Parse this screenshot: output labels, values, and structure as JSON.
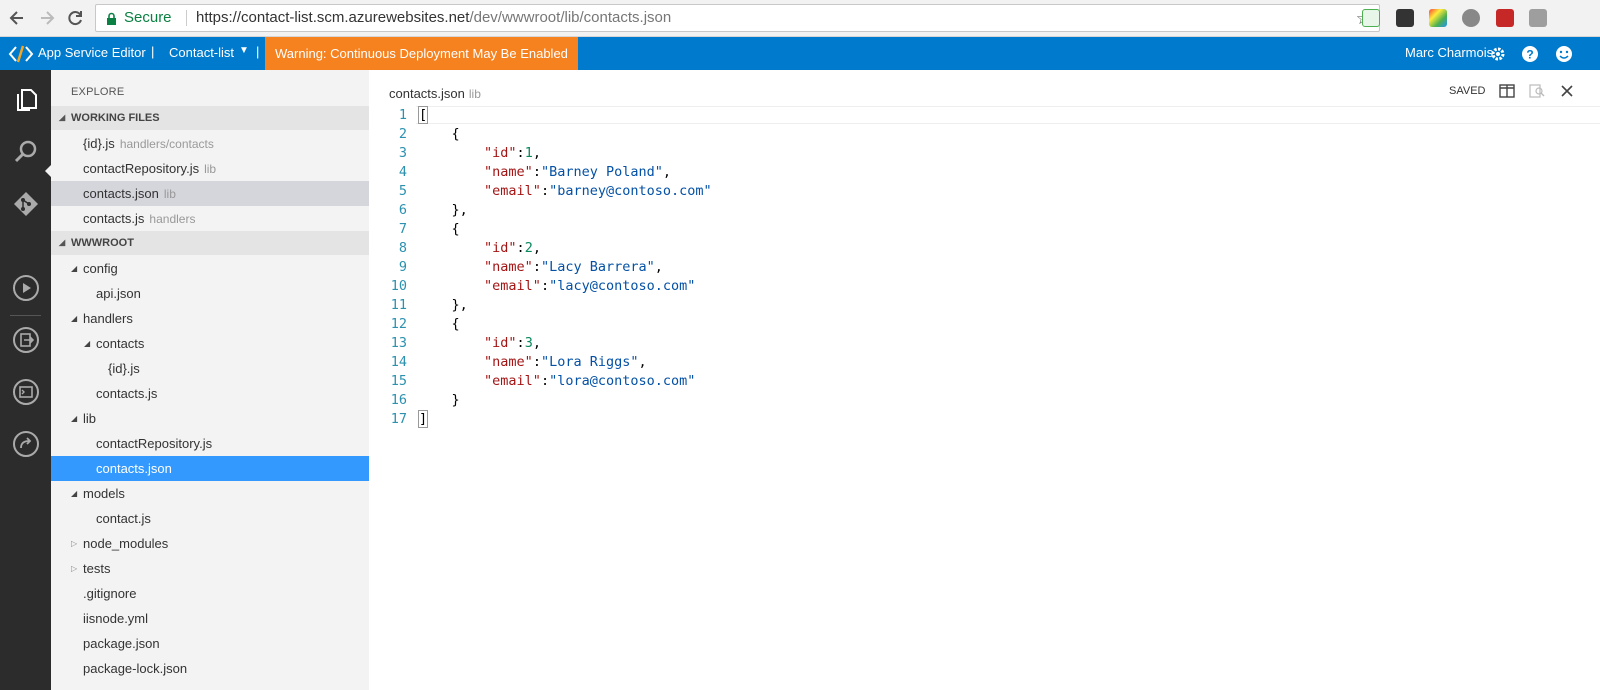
{
  "browser": {
    "secure_label": "Secure",
    "url_host": "https://contact-list.scm.azurewebsites.net",
    "url_path": "/dev/wwwroot/lib/contacts.json"
  },
  "header": {
    "app_name": "App Service Editor",
    "site_name": "Contact-list",
    "warning": "Warning: Continuous Deployment May Be Enabled",
    "user": "Marc Charmois",
    "accent_color": "#007acc",
    "warning_color": "#f5811f"
  },
  "sidebar": {
    "explore_label": "EXPLORE",
    "working_files_label": "WORKING FILES",
    "working_files": [
      {
        "name": "{id}.js",
        "desc": "handlers/contacts"
      },
      {
        "name": "contactRepository.js",
        "desc": "lib"
      },
      {
        "name": "contacts.json",
        "desc": "lib"
      },
      {
        "name": "contacts.js",
        "desc": "handlers"
      }
    ],
    "root_label": "WWWROOT",
    "tree": [
      {
        "name": "config"
      },
      {
        "name": "api.json"
      },
      {
        "name": "handlers"
      },
      {
        "name": "contacts"
      },
      {
        "name": "{id}.js"
      },
      {
        "name": "contacts.js"
      },
      {
        "name": "lib"
      },
      {
        "name": "contactRepository.js"
      },
      {
        "name": "contacts.json"
      },
      {
        "name": "models"
      },
      {
        "name": "contact.js"
      },
      {
        "name": "node_modules"
      },
      {
        "name": "tests"
      },
      {
        "name": ".gitignore"
      },
      {
        "name": "iisnode.yml"
      },
      {
        "name": "package.json"
      },
      {
        "name": "package-lock.json"
      }
    ]
  },
  "editor": {
    "file_name": "contacts.json",
    "file_dir": "lib",
    "status": "SAVED",
    "line_numbers": [
      "1",
      "2",
      "3",
      "4",
      "5",
      "6",
      "7",
      "8",
      "9",
      "10",
      "11",
      "12",
      "13",
      "14",
      "15",
      "16",
      "17"
    ],
    "contacts": [
      {
        "id": "1",
        "name": "\"Barney Poland\"",
        "email": "\"barney@contoso.com\""
      },
      {
        "id": "2",
        "name": "\"Lacy Barrera\"",
        "email": "\"lacy@contoso.com\""
      },
      {
        "id": "3",
        "name": "\"Lora Riggs\"",
        "email": "\"lora@contoso.com\""
      }
    ],
    "key_id": "\"id\"",
    "key_name": "\"name\"",
    "key_email": "\"email\""
  }
}
